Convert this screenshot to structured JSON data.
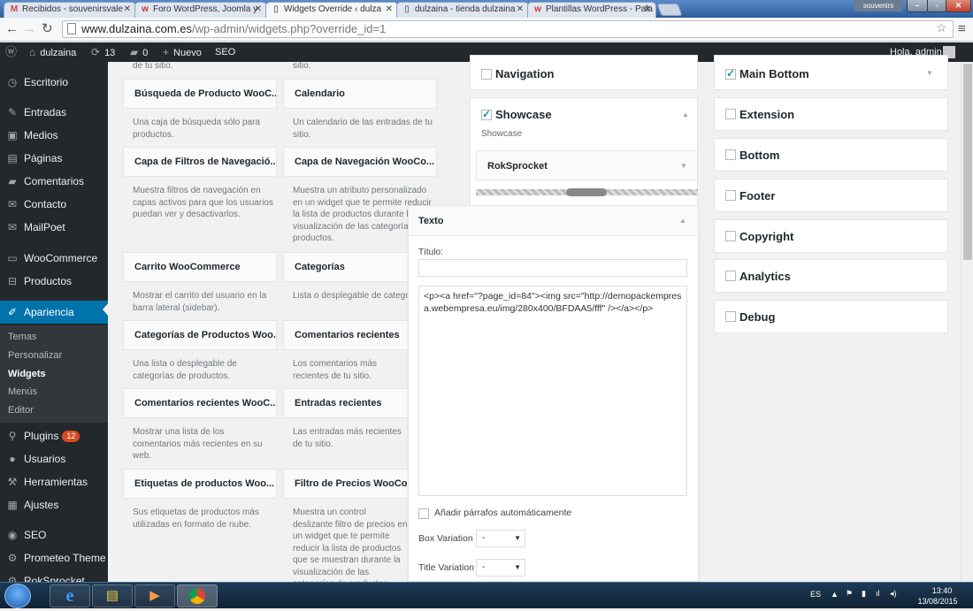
{
  "browser": {
    "tabs": [
      {
        "label": "Recibidos - souvenirsvale",
        "icon": "gmail-icon"
      },
      {
        "label": "Foro WordPress, Joomla y",
        "icon": "webempresa-icon"
      },
      {
        "label": "Widgets Override ‹ dulza",
        "icon": "page-icon"
      },
      {
        "label": "dulzaina - tienda dulzaina",
        "icon": "page-icon"
      },
      {
        "label": "Plantillas WordPress - Pala",
        "icon": "webempresa-icon"
      }
    ],
    "profile": "souvenirs",
    "url_host": "www.dulzaina.com.es",
    "url_path": "/wp-admin/widgets.php?override_id=1"
  },
  "adminbar": {
    "site": "dulzaina",
    "updates": "13",
    "comments": "0",
    "new": "Nuevo",
    "seo": "SEO",
    "greeting": "Hola, admin"
  },
  "sidebar": {
    "items": [
      {
        "label": "Escritorio",
        "icon": "dashboard-icon"
      },
      {
        "label": "Entradas",
        "icon": "pin-icon"
      },
      {
        "label": "Medios",
        "icon": "media-icon"
      },
      {
        "label": "Páginas",
        "icon": "pages-icon"
      },
      {
        "label": "Comentarios",
        "icon": "comment-icon"
      },
      {
        "label": "Contacto",
        "icon": "mail-icon"
      },
      {
        "label": "MailPoet",
        "icon": "mail-icon"
      },
      {
        "label": "WooCommerce",
        "icon": "woo-icon"
      },
      {
        "label": "Productos",
        "icon": "cart-icon"
      },
      {
        "label": "Apariencia",
        "icon": "brush-icon"
      },
      {
        "label": "Plugins",
        "icon": "plug-icon",
        "badge": "12"
      },
      {
        "label": "Usuarios",
        "icon": "user-icon"
      },
      {
        "label": "Herramientas",
        "icon": "wrench-icon"
      },
      {
        "label": "Ajustes",
        "icon": "settings-icon"
      },
      {
        "label": "SEO",
        "icon": "seo-icon"
      },
      {
        "label": "Prometeo Theme",
        "icon": "gear-icon"
      },
      {
        "label": "RokSprocket",
        "icon": "gear-icon"
      }
    ],
    "submenu": [
      "Temas",
      "Personalizar",
      "Widgets",
      "Menús",
      "Editor"
    ]
  },
  "available_widgets": {
    "top_fragments": [
      "de tu sitio.",
      "sitio."
    ],
    "left": [
      {
        "title": "Búsqueda de Producto WooC...",
        "desc": "Una caja de búsqueda sólo para productos."
      },
      {
        "title": "Capa de Filtros de Navegació...",
        "desc": "Muestra filtros de navegación en capas activos para que los usuarios puedan ver y desactivarlos."
      },
      {
        "title": "Carrito WooCommerce",
        "desc": "Mostrar el carrito del usuario en la barra lateral (sidebar)."
      },
      {
        "title": "Categorías de Productos Woo...",
        "desc": "Una lista o desplegable de categorías de productos."
      },
      {
        "title": "Comentarios recientes WooC...",
        "desc": "Mostrar una lista de los comentarios más recientes en su web."
      },
      {
        "title": "Etiquetas de productos Woo...",
        "desc": "Sus etiquetas de productos más utilizadas en formato de nube."
      }
    ],
    "right": [
      {
        "title": "Calendario",
        "desc": "Un calendario de las entradas de tu sitio."
      },
      {
        "title": "Capa de Navegación WooCo...",
        "desc": "Muestra un atributo personalizado en un widget que te permite reducir la lista de productos durante la visualización de las categorías de productos."
      },
      {
        "title": "Categorías",
        "desc": "Lista o desplegable de categor"
      },
      {
        "title": "Comentarios recientes",
        "desc": "Los comentarios más recientes de tu sitio."
      },
      {
        "title": "Entradas recientes",
        "desc": "Las entradas más recientes de tu sitio."
      },
      {
        "title": "Filtro de Precios WooComm",
        "desc": "Muestra un control deslizante filtro de precios en un widget que te permite reducir la lista de productos que se muestran durante la visualización de las categorías de productos."
      }
    ]
  },
  "sidebars_middle": {
    "navigation": "Navigation",
    "showcase": "Showcase",
    "showcase_desc": "Showcase",
    "roksprocket": "RokSprocket"
  },
  "texto_widget": {
    "header": "Texto",
    "title_label": "Título:",
    "title_value": "",
    "content": "<p><a href=\"?page_id=84\"><img src=\"http://demopackempresa.webempresa.eu/img/280x400/BFDAA5/fff\" /></a></p>",
    "autop_label": "Añadir párrafos automáticamente",
    "box_variation_label": "Box Variation",
    "box_variation_value": "-",
    "title_variation_label": "Title Variation",
    "title_variation_value": "-"
  },
  "sidebars_right": [
    {
      "label": "Main Bottom",
      "checked": true
    },
    {
      "label": "Extension",
      "checked": false
    },
    {
      "label": "Bottom",
      "checked": false
    },
    {
      "label": "Footer",
      "checked": false
    },
    {
      "label": "Copyright",
      "checked": false
    },
    {
      "label": "Analytics",
      "checked": false
    },
    {
      "label": "Debug",
      "checked": false
    }
  ],
  "taskbar": {
    "lang": "ES",
    "time": "13:40",
    "date": "13/08/2015"
  }
}
